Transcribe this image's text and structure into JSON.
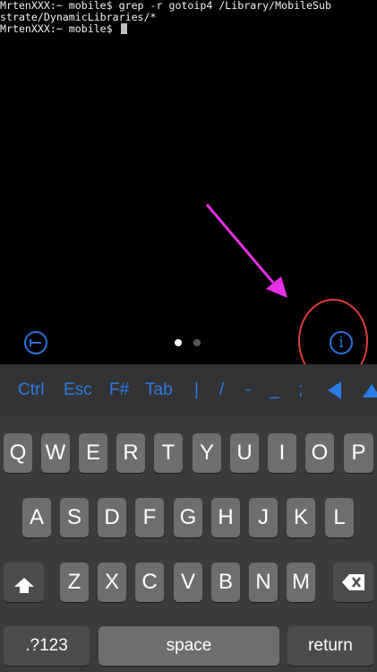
{
  "terminal": {
    "lines": [
      "MrtenXXX:~ mobile$ grep -r gotoip4 /Library/MobileSub",
      "strate/DynamicLibraries/*",
      "MrtenXXX:~ mobile$ "
    ],
    "cursor_char": "i"
  },
  "toolbar": {
    "hide_keyboard_icon": "hide-keyboard-icon",
    "info_icon": "info-icon",
    "info_glyph": "i",
    "page_count": 2,
    "active_page": 1
  },
  "accessory": {
    "keys": [
      "Ctrl",
      "Esc",
      "F#",
      "Tab",
      "|",
      "/",
      "-",
      "_",
      ";"
    ],
    "arrow_left_icon": "arrow-left-icon",
    "arrow_up_icon": "arrow-up-icon"
  },
  "keyboard": {
    "row1": [
      "Q",
      "W",
      "E",
      "R",
      "T",
      "Y",
      "U",
      "I",
      "O",
      "P"
    ],
    "row2": [
      "A",
      "S",
      "D",
      "F",
      "G",
      "H",
      "J",
      "K",
      "L"
    ],
    "row3": [
      "Z",
      "X",
      "C",
      "V",
      "B",
      "N",
      "M"
    ],
    "shift_icon": "shift-icon",
    "delete_icon": "delete-icon",
    "numbers_label": ".?123",
    "space_label": "space",
    "return_label": "return"
  },
  "colors": {
    "accent": "#2a7be4",
    "annotation_arrow": "#e62ee6",
    "annotation_ring": "#e23b3b"
  }
}
